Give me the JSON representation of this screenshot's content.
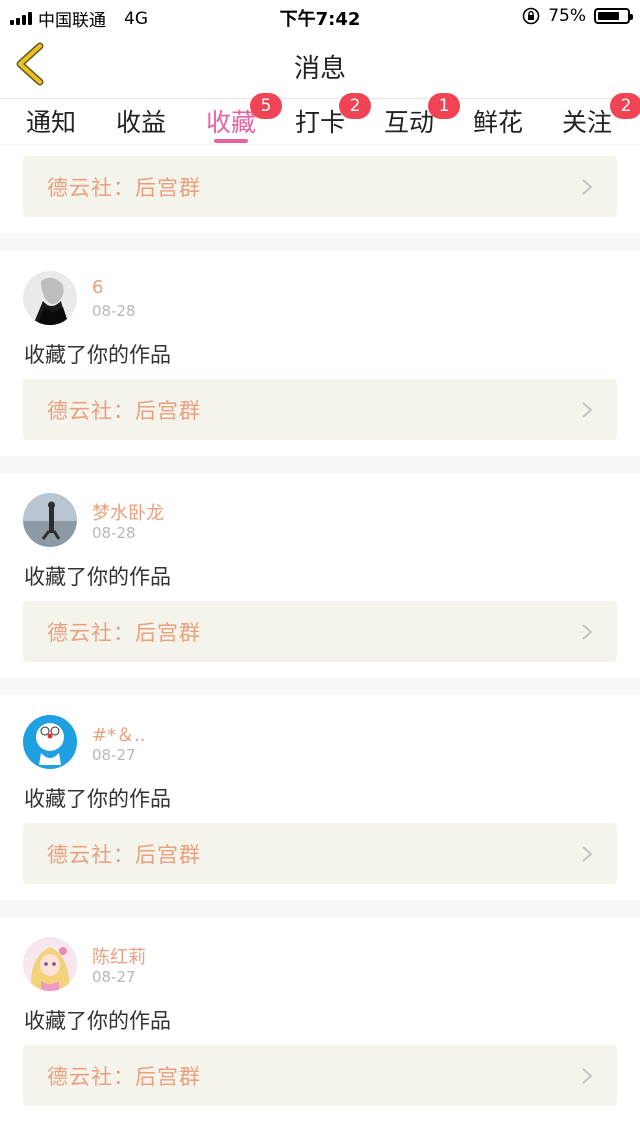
{
  "status_bar": {
    "carrier": "中国联通",
    "network": "4G",
    "time": "下午7:42",
    "battery_percent": "75%",
    "battery_level": 0.75
  },
  "nav": {
    "title": "消息",
    "back_icon": "chevron-left-icon",
    "accent_color": "#f0c020"
  },
  "tabs": [
    {
      "label": "通知",
      "badge": ""
    },
    {
      "label": "收益",
      "badge": ""
    },
    {
      "label": "收藏",
      "badge": "5",
      "active": true
    },
    {
      "label": "打卡",
      "badge": "2"
    },
    {
      "label": "互动",
      "badge": "1"
    },
    {
      "label": "鲜花",
      "badge": ""
    },
    {
      "label": "关注",
      "badge": "2"
    }
  ],
  "colors": {
    "active_tab": "#e8649f",
    "badge": "#f04455",
    "name_text": "#e8a07e",
    "group_bg": "#f4f4ec"
  },
  "first_group": {
    "label": "德云社：后宫群"
  },
  "messages": [
    {
      "name": "6",
      "date": "08-28",
      "action": "收藏了你的作品",
      "group": "德云社：后宫群",
      "avatar_icon": "portrait-avatar"
    },
    {
      "name": "梦水卧龙",
      "date": "08-28",
      "action": "收藏了你的作品",
      "group": "德云社：后宫群",
      "avatar_icon": "beach-photo-avatar"
    },
    {
      "name": "#*＆..",
      "date": "08-27",
      "action": "收藏了你的作品",
      "group": "德云社：后宫群",
      "avatar_icon": "doraemon-avatar"
    },
    {
      "name": "陈红莉",
      "date": "08-27",
      "action": "收藏了你的作品",
      "group": "德云社：后宫群",
      "avatar_icon": "anime-girl-avatar"
    }
  ]
}
